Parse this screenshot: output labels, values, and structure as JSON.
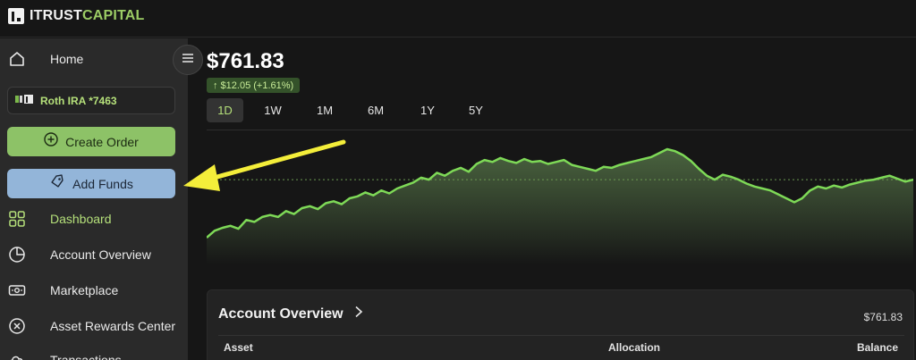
{
  "brand": {
    "name_part1": "ITRUST",
    "name_part2": "CAPITAL",
    "accent_color": "#9ccc65"
  },
  "sidebar": {
    "home_label": "Home",
    "account_label": "Roth IRA *7463",
    "create_order_label": "Create Order",
    "add_funds_label": "Add Funds",
    "items": [
      {
        "label": "Dashboard",
        "icon": "grid-icon",
        "active": true
      },
      {
        "label": "Account Overview",
        "icon": "pie-chart-icon",
        "active": false
      },
      {
        "label": "Marketplace",
        "icon": "cash-icon",
        "active": false
      },
      {
        "label": "Asset Rewards Center",
        "icon": "coin-icon",
        "active": false
      },
      {
        "label": "Transactions",
        "icon": "cloud-icon",
        "active": false
      }
    ]
  },
  "summary": {
    "price": "$761.83",
    "change": "↑ $12.05 (+1.61%)",
    "change_color": "#34522a"
  },
  "ranges": [
    {
      "label": "1D",
      "active": true
    },
    {
      "label": "1W",
      "active": false
    },
    {
      "label": "1M",
      "active": false
    },
    {
      "label": "6M",
      "active": false
    },
    {
      "label": "1Y",
      "active": false
    },
    {
      "label": "5Y",
      "active": false
    }
  ],
  "chart_data": {
    "type": "area",
    "series": [
      {
        "values": [
          40,
          47,
          50,
          52,
          49,
          58,
          56,
          61,
          63,
          61,
          67,
          64,
          70,
          72,
          69,
          75,
          77,
          74,
          80,
          82,
          86,
          83,
          88,
          85,
          90,
          93,
          96,
          101,
          99,
          106,
          103,
          108,
          111,
          107,
          115,
          119,
          117,
          121,
          118,
          116,
          120,
          117,
          118,
          115,
          117,
          119,
          114,
          112,
          110,
          108,
          112,
          111,
          114,
          116,
          118,
          120,
          122,
          126,
          130,
          128,
          124,
          118,
          110,
          103,
          99,
          104,
          102,
          99,
          95,
          92,
          90,
          88,
          84,
          80,
          76,
          80,
          88,
          92,
          90,
          93,
          91,
          94,
          96,
          98,
          99,
          101,
          103,
          100,
          97,
          99
        ]
      }
    ],
    "baseline": 99,
    "line_color": "#7ed957",
    "fill_top": "#4f6b43",
    "fill_bottom": "#161616",
    "grid": false
  },
  "account_overview": {
    "title": "Account Overview",
    "balance": "$761.83",
    "columns": [
      "Asset",
      "Allocation",
      "Balance"
    ]
  },
  "annotation": {
    "arrow_color": "#f4ee3a"
  }
}
